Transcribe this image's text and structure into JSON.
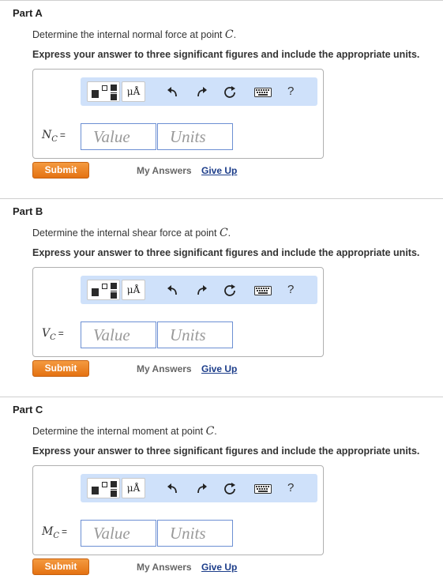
{
  "parts": [
    {
      "title": "Part A",
      "question_prefix": "Determine the internal normal force at point",
      "point": "C",
      "question_suffix": ".",
      "instruction": "Express your answer to three significant figures and include the appropriate units.",
      "var_symbol": "N",
      "var_sub": "C",
      "equals": "=",
      "value_placeholder": "Value",
      "units_placeholder": "Units",
      "submit_label": "Submit",
      "my_answers_label": "My Answers",
      "give_up_label": "Give Up"
    },
    {
      "title": "Part B",
      "question_prefix": "Determine the internal shear force at point",
      "point": "C",
      "question_suffix": ".",
      "instruction": "Express your answer to three significant figures and include the appropriate units.",
      "var_symbol": "V",
      "var_sub": "C",
      "equals": "=",
      "value_placeholder": "Value",
      "units_placeholder": "Units",
      "submit_label": "Submit",
      "my_answers_label": "My Answers",
      "give_up_label": "Give Up"
    },
    {
      "title": "Part C",
      "question_prefix": "Determine the internal moment at point",
      "point": "C",
      "question_suffix": ".",
      "instruction": "Express your answer to three significant figures and include the appropriate units.",
      "var_symbol": "M",
      "var_sub": "C",
      "equals": "=",
      "value_placeholder": "Value",
      "units_placeholder": "Units",
      "submit_label": "Submit",
      "my_answers_label": "My Answers",
      "give_up_label": "Give Up"
    }
  ],
  "toolbar": {
    "units_button_label": "μÅ",
    "help_label": "?",
    "icons": [
      "templates-icon",
      "units-icon",
      "undo-icon",
      "redo-icon",
      "reset-icon",
      "keyboard-icon",
      "help-icon"
    ]
  },
  "colors": {
    "toolbar_bg": "#cfe1fa",
    "submit_bg": "#ec8324",
    "input_border": "#6c8fd3",
    "give_up_link": "#1c3d8a"
  }
}
